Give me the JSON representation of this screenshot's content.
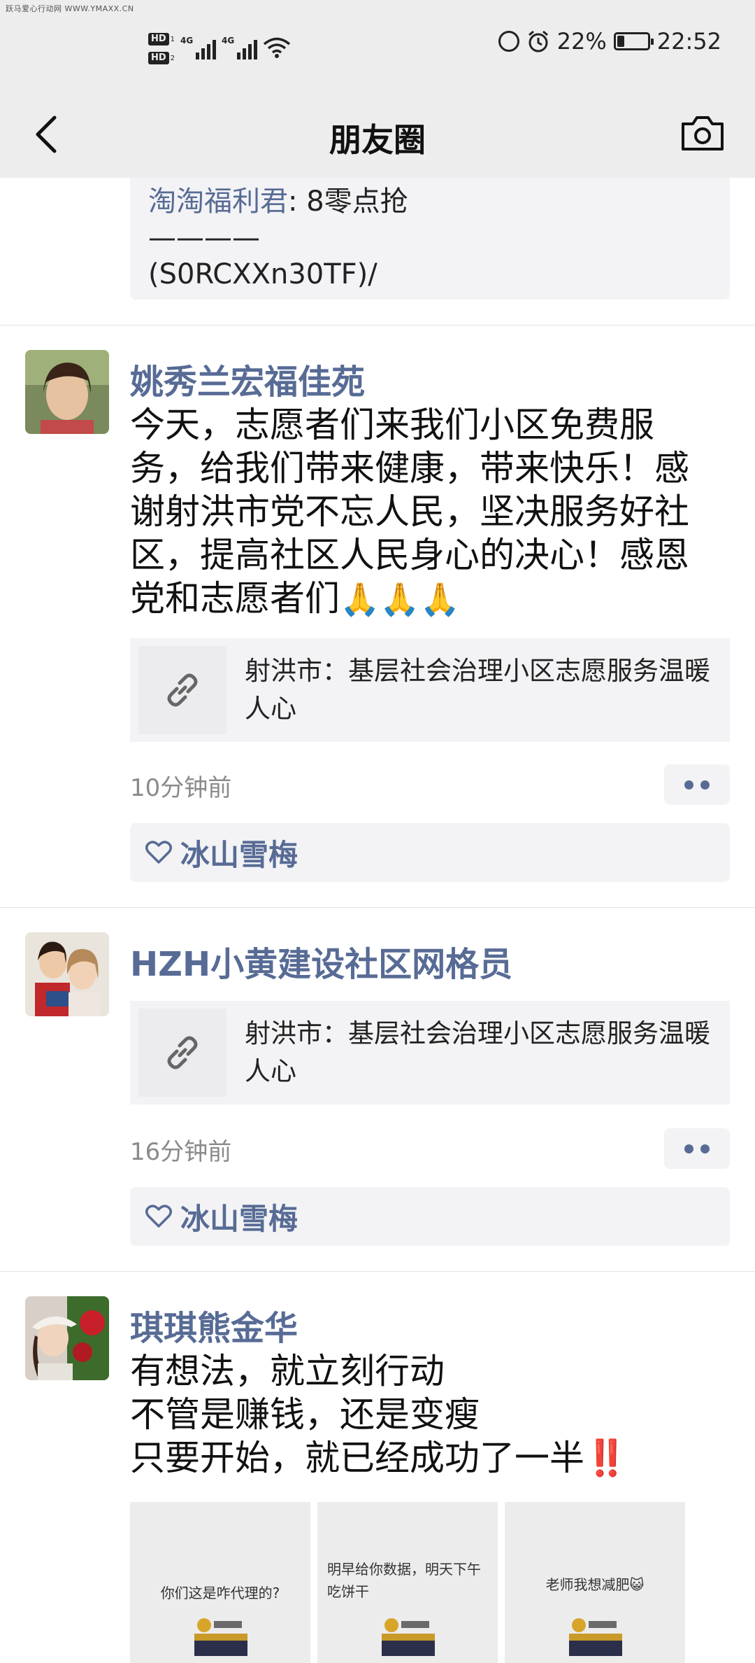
{
  "watermark": "跃马爱心行动网 WWW.YMAXX.CN",
  "status_bar": {
    "hd1": "HD",
    "hd1_sub": "1",
    "hd2": "HD",
    "hd2_sub": "2",
    "net1": "4G",
    "net2": "4G",
    "battery_text": "22%",
    "battery_level": 0.22,
    "time": "22:52"
  },
  "nav": {
    "title": "朋友圈",
    "back_icon": "chevron-left-icon",
    "camera_icon": "camera-icon"
  },
  "previous_post": {
    "comment_name": "淘淘福利君",
    "comment_text": ": 8零点抢",
    "line2": "————",
    "line3": "(S0RCXXn30TF)/"
  },
  "posts": [
    {
      "name": "姚秀兰宏福佳苑",
      "text_lines": [
        "今天，志愿者们来我们小区免费服",
        "务，给我们带来健康，带来快乐！感",
        "谢射洪市党不忘人民，坚决服务好社",
        "区，提高社区人民身心的决心！感恩",
        "党和志愿者们"
      ],
      "emoji": "🙏🙏🙏",
      "link_title": "射洪市：基层社会治理小区志愿服务温暖人心",
      "time": "10分钟前",
      "like_name": "冰山雪梅"
    },
    {
      "name": "HZH小黄建设社区网格员",
      "link_title": "射洪市：基层社会治理小区志愿服务温暖人心",
      "time": "16分钟前",
      "like_name": "冰山雪梅"
    },
    {
      "name": "琪琪熊金华",
      "text_lines": [
        "有想法，就立刻行动",
        "不管是赚钱，还是变瘦",
        "只要开始，就已经成功了一半"
      ],
      "bang": "‼️",
      "images": [
        {
          "text": "你们这是咋代理的?"
        },
        {
          "text": "明早给你数据，明天下午吃饼干"
        },
        {
          "text": "老师我想减肥😺"
        }
      ]
    }
  ],
  "colors": {
    "name_blue": "#576b95",
    "bar_bg": "#ededed",
    "box_bg": "#f3f3f5"
  }
}
